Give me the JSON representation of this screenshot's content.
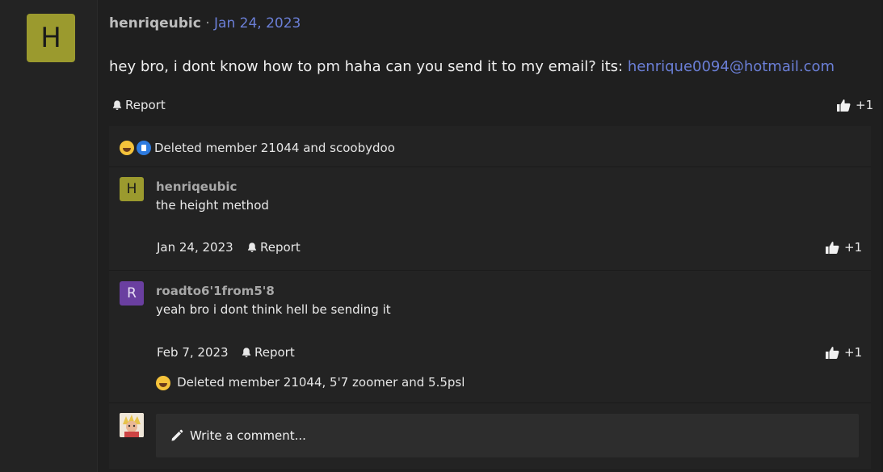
{
  "post": {
    "avatar_letter": "H",
    "username": "henriqeubic",
    "separator": "·",
    "date": "Jan 24, 2023",
    "body_text": "hey bro, i dont know how to pm haha can you send it to my email? its:",
    "email": "henrique0094@hotmail.com",
    "report_label": "Report",
    "like_count": "+1",
    "reactions_text": "Deleted member 21044 and scoobydoo"
  },
  "comments": [
    {
      "avatar_letter": "H",
      "username": "henriqeubic",
      "text": "the height method",
      "date": "Jan 24, 2023",
      "report_label": "Report",
      "like_count": "+1"
    },
    {
      "avatar_letter": "R",
      "username": "roadto6'1from5'8",
      "text": "yeah bro i dont think hell be sending it",
      "date": "Feb 7, 2023",
      "report_label": "Report",
      "like_count": "+1",
      "reactions_text": "Deleted member 21044, 5'7 zoomer and 5.5psl"
    }
  ],
  "composer": {
    "placeholder": "Write a comment..."
  },
  "colors": {
    "accent_link": "#6b7fd7",
    "avatar_h": "#9b9a2e",
    "avatar_r": "#6a3fa0"
  }
}
